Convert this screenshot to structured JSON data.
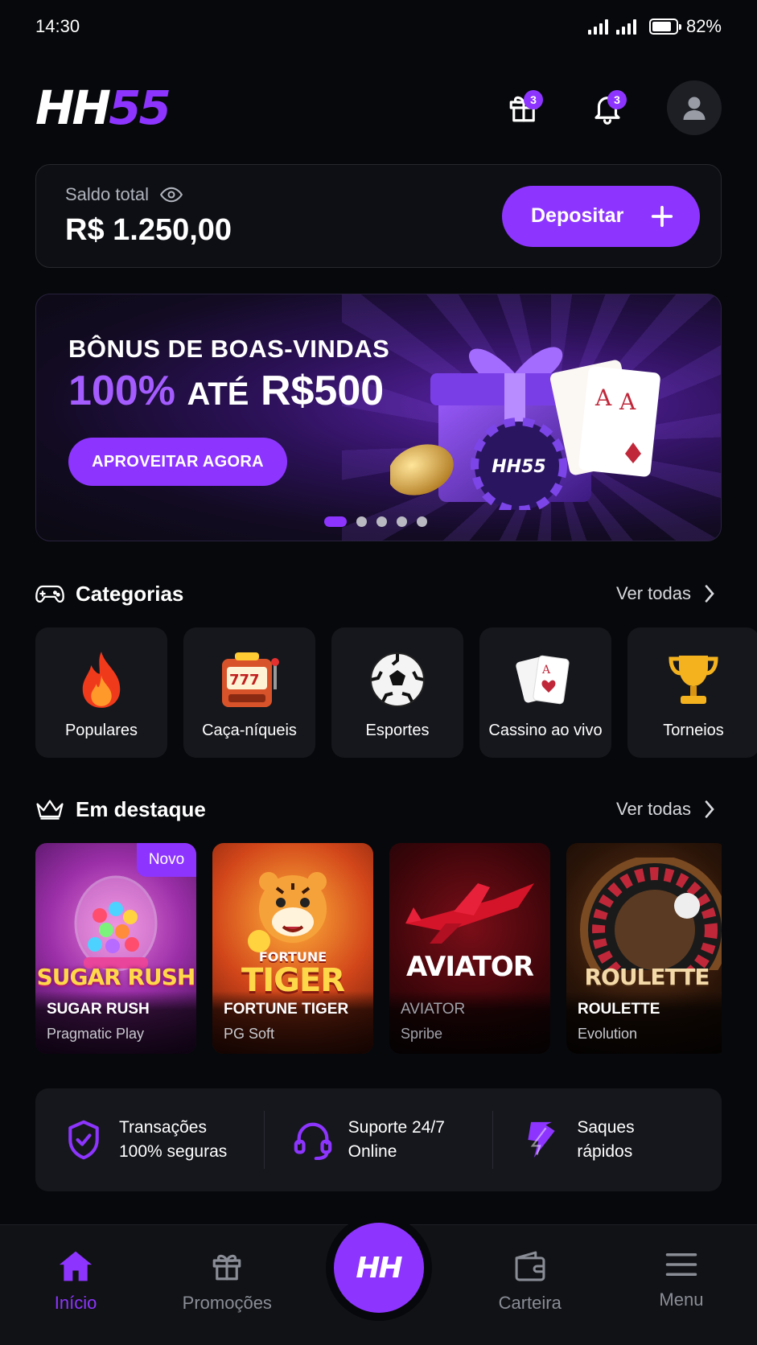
{
  "status_bar": {
    "time": "14:30",
    "battery": "82%",
    "battery_level": 0.82
  },
  "header": {
    "logo_white": "HH",
    "logo_purple": "55",
    "gift_badge": "3",
    "bell_badge": "3"
  },
  "balance": {
    "label": "Saldo total",
    "value": "R$ 1.250,00",
    "deposit_label": "Depositar"
  },
  "banner": {
    "line1": "BÔNUS DE BOAS-VINDAS",
    "percent": "100%",
    "ate": "ATÉ",
    "amount": "R$500",
    "cta": "APROVEITAR AGORA",
    "chip_text": "HH55",
    "active_slide": 1,
    "slide_count": 5
  },
  "categories": {
    "title": "Categorias",
    "see_all": "Ver todas",
    "items": [
      {
        "label": "Populares",
        "icon": "fire-icon"
      },
      {
        "label": "Caça-níqueis",
        "icon": "slot-machine-icon"
      },
      {
        "label": "Esportes",
        "icon": "soccer-ball-icon"
      },
      {
        "label": "Cassino ao vivo",
        "icon": "playing-cards-icon"
      },
      {
        "label": "Torneios",
        "icon": "trophy-icon"
      }
    ]
  },
  "featured": {
    "title": "Em destaque",
    "see_all": "Ver todas",
    "items": [
      {
        "art_title": "SUGAR RUSH",
        "name": "SUGAR RUSH",
        "provider": "Pragmatic Play",
        "tag": "Novo"
      },
      {
        "art_title": "TIGER",
        "art_subtitle": "FORTUNE",
        "name": "FORTUNE TIGER",
        "provider": "PG Soft"
      },
      {
        "art_title": "AVIATOR",
        "name": "AVIATOR",
        "provider": "Spribe"
      },
      {
        "art_title": "ROULETTE",
        "name": "ROULETTE",
        "provider": "Evolution"
      }
    ]
  },
  "features": [
    {
      "line1": "Transações",
      "line2": "100% seguras",
      "icon": "shield-check-icon"
    },
    {
      "line1": "Suporte 24/7",
      "line2": "Online",
      "icon": "headset-icon"
    },
    {
      "line1": "Saques",
      "line2": "rápidos",
      "icon": "lightning-icon"
    }
  ],
  "nav": {
    "home": "Início",
    "promos": "Promoções",
    "center": "HH",
    "wallet": "Carteira",
    "menu": "Menu"
  },
  "colors": {
    "accent": "#8d35ff",
    "background": "#07080b",
    "card": "#16171c"
  }
}
